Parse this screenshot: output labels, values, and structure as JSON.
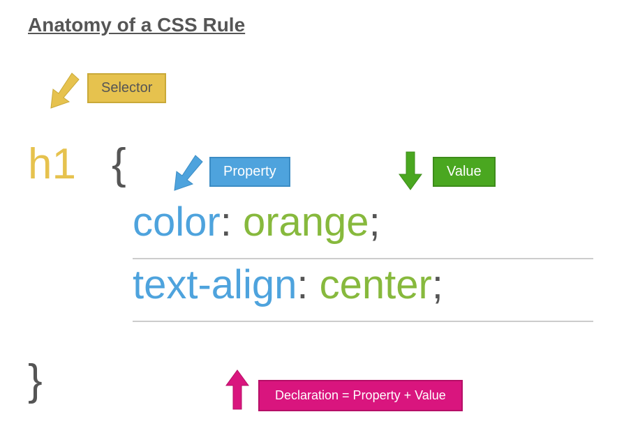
{
  "title": "Anatomy of a CSS Rule",
  "labels": {
    "selector": "Selector",
    "property": "Property",
    "value": "Value",
    "declaration": "Declaration = Property + Value"
  },
  "code": {
    "selector": "h1",
    "brace_open": "{",
    "brace_close": "}",
    "declarations": [
      {
        "property": "color",
        "value": "orange"
      },
      {
        "property": "text-align",
        "value": "center"
      }
    ],
    "colon": ":",
    "semicolon": ";"
  },
  "colors": {
    "selector_box": "#e6c24e",
    "property_box": "#4ea3dd",
    "value_box": "#4aa720",
    "declaration_box": "#d9157e",
    "property_text": "#4ea3dd",
    "value_text": "#87b93d",
    "selector_text": "#e6c24e",
    "punct_text": "#555555"
  }
}
